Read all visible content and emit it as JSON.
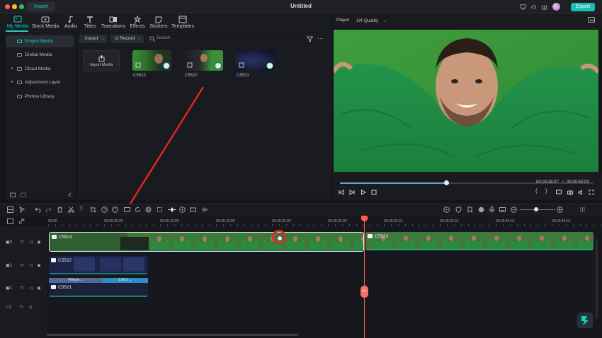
{
  "app": {
    "title": "Untitled",
    "import_tab": "Import",
    "export_label": "Export"
  },
  "toolbar": {
    "tabs": [
      {
        "label": "My Media",
        "icon": "my-media-icon",
        "active": true
      },
      {
        "label": "Stock Media",
        "icon": "stock-media-icon"
      },
      {
        "label": "Audio",
        "icon": "audio-icon"
      },
      {
        "label": "Titles",
        "icon": "titles-icon"
      },
      {
        "label": "Transitions",
        "icon": "transitions-icon"
      },
      {
        "label": "Effects",
        "icon": "effects-icon"
      },
      {
        "label": "Stickers",
        "icon": "stickers-icon"
      },
      {
        "label": "Templates",
        "icon": "templates-icon"
      }
    ]
  },
  "sidebar": {
    "items": [
      {
        "label": "Project Media",
        "selected": true
      },
      {
        "label": "Global Media"
      },
      {
        "label": "Cloud Media"
      },
      {
        "label": "Adjustment Layer"
      },
      {
        "label": "Photos Library"
      }
    ]
  },
  "media": {
    "import_label": "Import",
    "record_label": "Record",
    "search_placeholder": "Search",
    "import_media_label": "Import Media",
    "items": [
      {
        "name": "C5523",
        "checked": true
      },
      {
        "name": "C5522",
        "checked": true
      },
      {
        "name": "C5521",
        "checked": true
      }
    ]
  },
  "player": {
    "label": "Player",
    "quality": "1/4 Quality",
    "current_time": "00:00:28:07",
    "total_time": "00:00:50:03",
    "progress": 0.42
  },
  "timeline": {
    "ruler_labels": [
      "00:00",
      "00:00:05:00",
      "00:00:10:00",
      "00:00:15:00",
      "00:00:20:00",
      "00:00:25:00",
      "00:00:30:01",
      "00:00:35:01",
      "00:00:40:01",
      "00:00:45:01"
    ],
    "tracks": [
      {
        "number": "3",
        "clip_name": "C5523",
        "clip_name_right": "C5523"
      },
      {
        "number": "2",
        "clip_name": "C5522"
      },
      {
        "number": "1",
        "clip_name": "C5521",
        "freeze_label": "Freeze",
        "speed_label": "1.00 x"
      },
      {
        "number": "1",
        "type": "audio"
      }
    ]
  },
  "colors": {
    "accent": "#19d1c1",
    "playhead": "#ff5a52",
    "export": "#19bfb4"
  }
}
